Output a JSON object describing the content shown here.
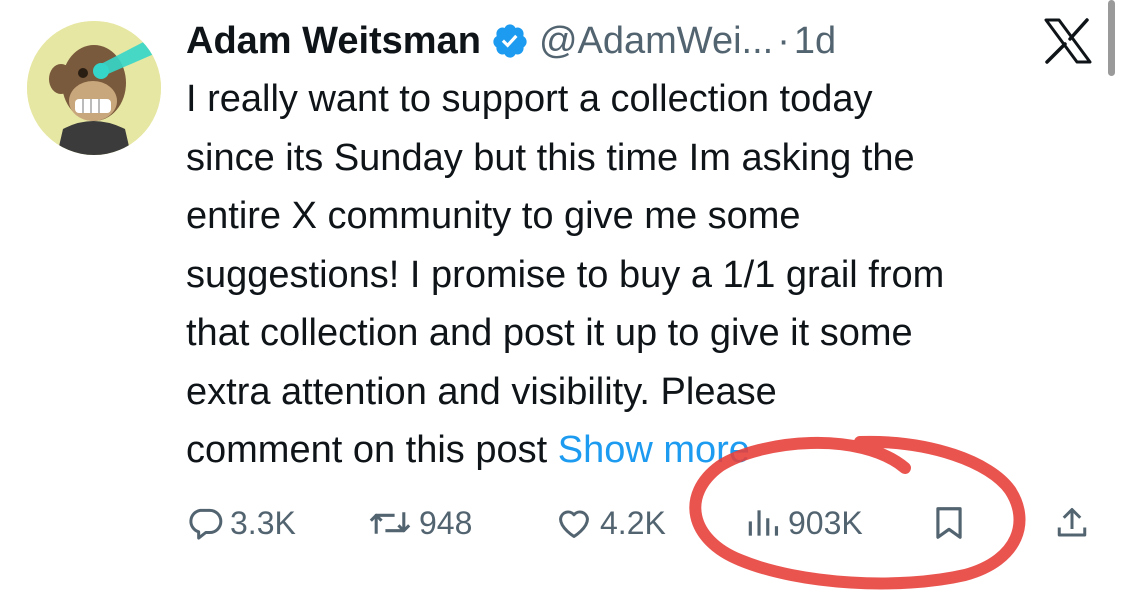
{
  "tweet": {
    "author_name": "Adam Weitsman",
    "handle": "@AdamWei...",
    "separator": "·",
    "age": "1d",
    "body_lines": [
      "I really want to support a collection today",
      "since its Sunday but this time Im asking the",
      "entire X community to give me some",
      "suggestions! I promise to buy a 1/1 grail from",
      "that collection and post it up to give it some",
      "extra attention and visibility.  Please",
      "comment on this post "
    ],
    "show_more": "Show more"
  },
  "stats": {
    "replies": "3.3K",
    "reposts": "948",
    "likes": "4.2K",
    "views": "903K"
  },
  "icons": {
    "verified": "verified-badge-icon",
    "platform": "x-logo-icon",
    "reply": "reply-bubble-icon",
    "repost": "repost-icon",
    "like": "heart-icon",
    "views": "views-chart-icon",
    "bookmark": "bookmark-icon",
    "share": "share-icon"
  },
  "colors": {
    "text": "#0f1419",
    "secondary": "#536471",
    "link": "#1d9bf0",
    "verified": "#1d9bf0",
    "annotation": "#e8413c"
  }
}
